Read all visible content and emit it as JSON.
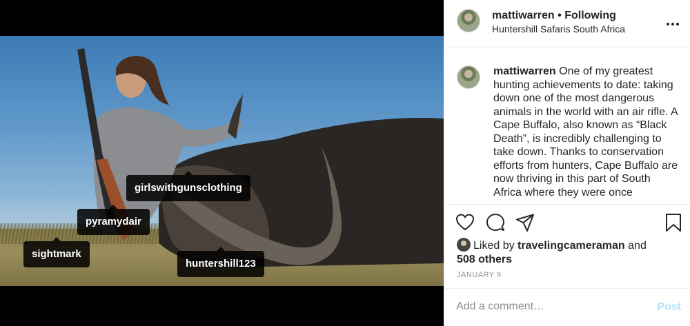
{
  "photo": {
    "tags": [
      "girlswithgunsclothing",
      "pyramydair",
      "sightmark",
      "huntershill123"
    ]
  },
  "header": {
    "username": "mattiwarren",
    "separator": "•",
    "follow_status": "Following",
    "location": "Huntershill Safaris South Africa"
  },
  "caption": {
    "username": "mattiwarren",
    "text": "One of my greatest hunting achievements to date: taking down one of the most dangerous animals in the world with an air rifle. A Cape Buffalo, also known as “Black Death”, is incredibly challenging to take down. Thanks to conservation efforts from hunters, Cape Buffalo are now thriving in this part of South Africa where they were once"
  },
  "likes": {
    "prefix": "Liked by",
    "user": "travelingcameraman",
    "conjunction": "and",
    "others": "508 others"
  },
  "date": "JANUARY 9",
  "comment": {
    "placeholder": "Add a comment…",
    "post_label": "Post"
  },
  "colors": {
    "text": "#262626",
    "muted": "#8e8e8e",
    "post_disabled": "#b2dffc",
    "tag_bg": "#000000"
  },
  "icons": [
    "more-options-icon",
    "heart-icon",
    "comment-icon",
    "share-icon",
    "bookmark-icon",
    "user-tag-icon"
  ]
}
